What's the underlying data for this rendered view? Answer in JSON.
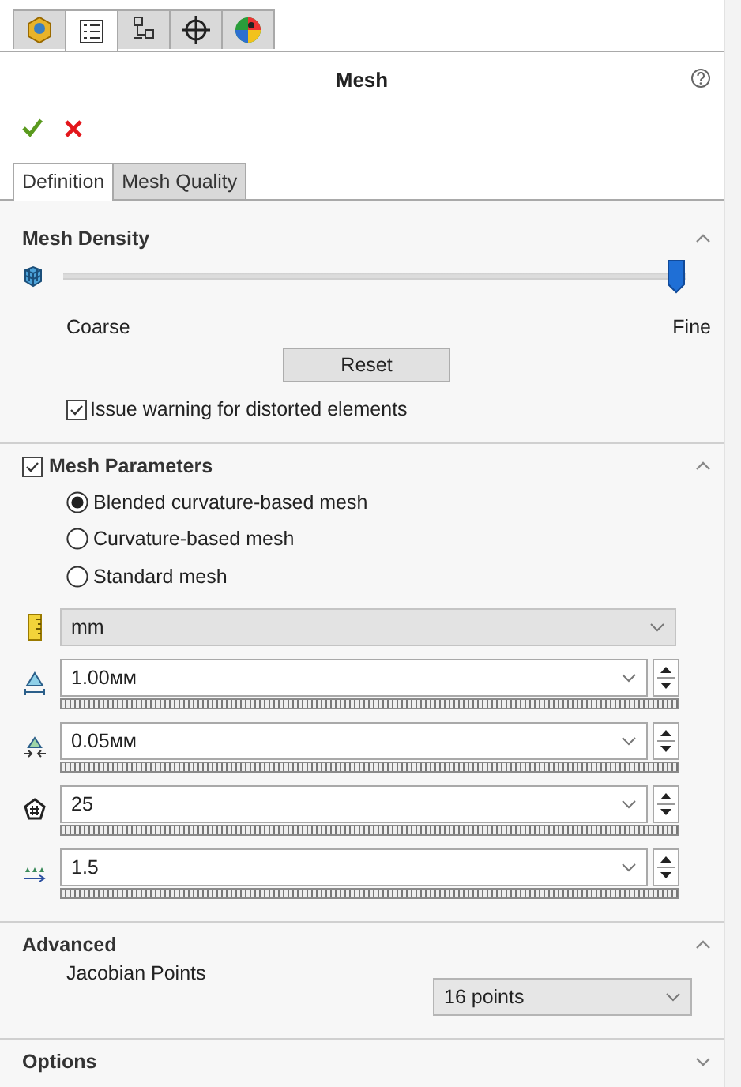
{
  "icon_tabs": [
    {
      "kind": "part",
      "selected": false
    },
    {
      "kind": "tree",
      "selected": true
    },
    {
      "kind": "config",
      "selected": false
    },
    {
      "kind": "target",
      "selected": false
    },
    {
      "kind": "appearance",
      "selected": false
    }
  ],
  "title": "Mesh",
  "tabs": [
    {
      "label": "Definition",
      "selected": true
    },
    {
      "label": "Mesh Quality",
      "selected": false
    }
  ],
  "sections": [
    {
      "kind": "density",
      "title": "Mesh Density",
      "expanded": true,
      "level": 1,
      "low_label": "Coarse",
      "high_label": "Fine",
      "button": "Reset",
      "checkbox": {
        "label": "Issue warning for distorted elements",
        "checked": true
      }
    },
    {
      "kind": "parameters",
      "title": "Mesh Parameters",
      "checked": true,
      "expanded": true,
      "options": [
        {
          "label": "Blended curvature-based mesh",
          "selected": true
        },
        {
          "label": "Curvature-based mesh",
          "selected": false
        },
        {
          "label": "Standard mesh",
          "selected": false
        }
      ],
      "unit": "mm",
      "fields": [
        {
          "kind": "max-size",
          "value": "1.00мм"
        },
        {
          "kind": "min-size",
          "value": "0.05мм"
        },
        {
          "kind": "circle-count",
          "value": "25"
        },
        {
          "kind": "growth",
          "value": "1.5"
        }
      ]
    },
    {
      "kind": "advanced",
      "title": "Advanced",
      "expanded": true,
      "label": "Jacobian Points",
      "value": "16 points"
    },
    {
      "kind": "options",
      "title": "Options",
      "expanded": false
    }
  ]
}
